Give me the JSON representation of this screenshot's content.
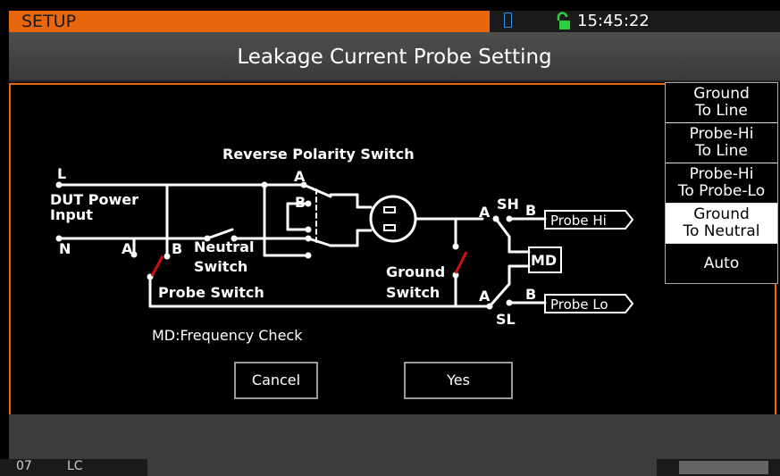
{
  "status": {
    "mode": "SETUP",
    "time": "15:45:22"
  },
  "dialog": {
    "title": "Leakage Current Probe Setting",
    "caption": "MD:Frequency Check",
    "cancel_label": "Cancel",
    "yes_label": "Yes"
  },
  "menu": {
    "items": [
      {
        "line1": "Ground",
        "line2": "To Line"
      },
      {
        "line1": "Probe-Hi",
        "line2": "To Line"
      },
      {
        "line1": "Probe-Hi",
        "line2": "To Probe-Lo"
      },
      {
        "line1": "Ground",
        "line2": "To Neutral"
      },
      {
        "line1": "Auto",
        "line2": ""
      }
    ],
    "selected": "Ground To Neutral"
  },
  "diagram": {
    "reverse_polarity": "Reverse Polarity Switch",
    "label_L": "L",
    "label_N": "N",
    "dut_line1": "DUT Power",
    "dut_line2": "Input",
    "label_A": "A",
    "label_B": "B",
    "neutral_line1": "Neutral",
    "neutral_line2": "Switch",
    "probe_switch": "Probe  Switch",
    "ground_line1": "Ground",
    "ground_line2": "Switch",
    "sh": "SH",
    "sl": "SL",
    "md": "MD",
    "probe_hi": "Probe  Hi",
    "probe_lo": "Probe  Lo"
  },
  "bottom": {
    "c1": "07",
    "c2": "LC"
  },
  "colors": {
    "accent": "#e8660c",
    "switch_red": "#d01010",
    "lock_green": "#2ecc40",
    "battery_blue": "#2f8fe6"
  }
}
